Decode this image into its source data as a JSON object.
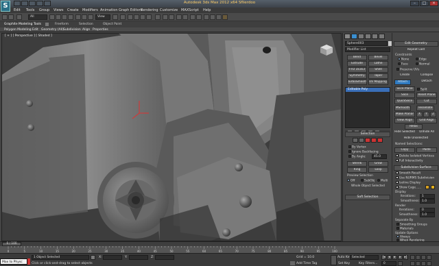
{
  "app": {
    "title": "Autodesk 3ds Max 2012 x64     Sflierdoo",
    "logo_text": "S"
  },
  "menu": [
    "Edit",
    "Tools",
    "Group",
    "Views",
    "Create",
    "Modifiers",
    "Animation",
    "Graph Editors",
    "Rendering",
    "Customize",
    "MAXScript",
    "Help"
  ],
  "toolbar": {
    "selection_filter": "All",
    "view_dropdown": "View"
  },
  "ribbon": {
    "top_tabs": [
      "Graphite Modeling Tools",
      "Freeform",
      "Selection",
      "Object Paint"
    ],
    "sub_tabs": [
      "Polygon Modeling",
      "Edit",
      "Geometry (All)",
      "Subdivision",
      "Align",
      "Properties"
    ]
  },
  "viewport": {
    "label": "[ + ] [ Perspective ] [ Shaded ]"
  },
  "command_panel": {
    "object_name": "Sphere003",
    "modifier_list": "Modifier List",
    "modifier_buttons": [
      "Bend",
      "Bevel",
      "Extrude",
      "Lathe",
      "FFD 3x3x3",
      "Shell",
      "Symmetry",
      "Taper",
      "TurboSmooth",
      "UV Mapping Cle"
    ],
    "stack_item": "Editable Poly",
    "selection_title": "Selection",
    "by_vertex": "By Vertex",
    "ignore_backfacing": "Ignore Backfacing",
    "by_angle": "By Angle:",
    "by_angle_value": "45.0",
    "shrink": "Shrink",
    "grow": "Grow",
    "ring": "Ring",
    "loop": "Loop",
    "preview_selection": "Preview Selection",
    "preview_options": [
      "Off",
      "SubObj",
      "Multi"
    ],
    "whole_object_selected": "Whole Object Selected",
    "soft_selection": "Soft Selection"
  },
  "edit_panel": {
    "edit_geometry": "Edit Geometry",
    "repeat_last": "Repeat Last",
    "constraints": "Constraints",
    "constraint_options": [
      "None",
      "Edge",
      "Face",
      "Normal"
    ],
    "preserve_uvs": "Preserve UVs",
    "create": "Create",
    "collapse": "Collapse",
    "attach": "Attach",
    "detach": "Detach",
    "slice_plane": "Slice Plane",
    "split": "Split",
    "slice": "Slice",
    "reset_plane": "Reset Plane",
    "quickslice": "QuickSlice",
    "cut": "Cut",
    "msmooth": "MSmooth",
    "tessellate": "Tessellate",
    "make_planar": "Make Planar",
    "xyz": [
      "X",
      "Y",
      "Z"
    ],
    "view_align": "View Align",
    "grid_align": "Grid Align",
    "relax": "Relax",
    "hide_selected": "Hide Selected",
    "unhide_all": "Unhide All",
    "hide_unselected": "Hide Unselected",
    "named_selections": "Named Selections:",
    "copy": "Copy",
    "paste": "Paste",
    "delete_isolated": "Delete Isolated Vertices",
    "full_interactivity": "Full Interactivity",
    "subdivision_surface": "Subdivision Surface",
    "smooth_result": "Smooth Result",
    "use_nurms": "Use NURMS Subdivision",
    "isoline_display": "Isoline Display",
    "show_cage": "Show Cage......",
    "display": "Display",
    "iterations_label": "Iterations:",
    "iterations_value": "1",
    "smoothness_label": "Smoothness:",
    "smoothness_value": "1.0",
    "render": "Render",
    "render_iterations_value": "0",
    "render_smoothness_value": "1.0",
    "separate_by": "Separate By",
    "smoothing_groups": "Smoothing Groups",
    "materials": "Materials",
    "update_options": "Update Options",
    "update_choices": [
      "Always",
      "When Rendering",
      "Manually"
    ],
    "cage_colors": [
      "#d8a020",
      "#e2b020"
    ]
  },
  "timeline": {
    "frame_display": "0 / 100",
    "ticks": [
      "0",
      "5",
      "10",
      "15",
      "20",
      "25",
      "30",
      "35",
      "40",
      "45",
      "50",
      "55",
      "60",
      "65",
      "70",
      "75",
      "80",
      "85",
      "90",
      "95",
      "100"
    ]
  },
  "status": {
    "maxscript_label": "Max to Physc",
    "objects_selected": "1 Object Selected",
    "prompt": "Click or click-and-drag to select objects",
    "x_label": "X:",
    "y_label": "Y:",
    "z_label": "Z:",
    "grid": "Grid = 10.0",
    "add_time_tag": "Add Time Tag",
    "auto_key": "Auto Key",
    "set_key": "Set Key",
    "selected": "Selected",
    "key_filters": "Key Filters...",
    "frame_value": "0"
  }
}
